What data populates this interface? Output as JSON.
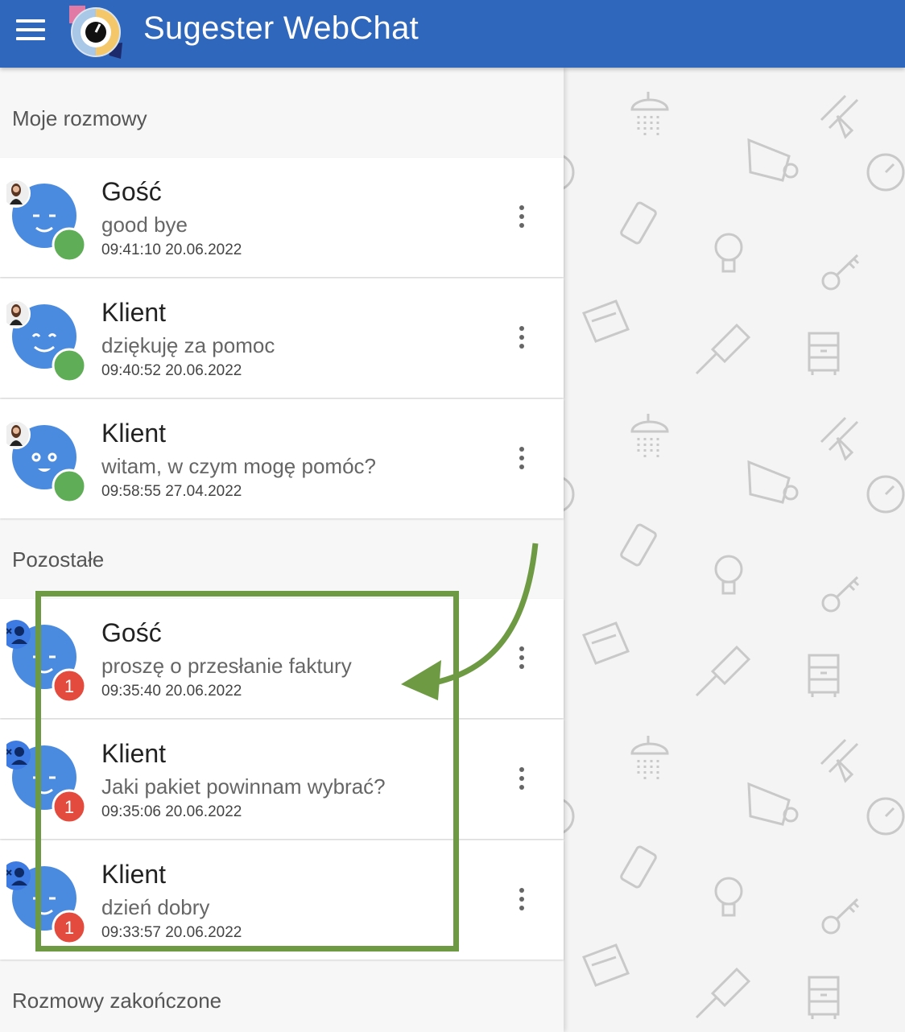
{
  "header": {
    "title": "Sugester WebChat",
    "colors": {
      "bar": "#2f67bd"
    }
  },
  "sections": [
    {
      "title": "Moje rozmowy"
    },
    {
      "title": "Pozostałe"
    },
    {
      "title": "Rozmowy zakończone"
    }
  ],
  "conversations": [
    {
      "name": "Gość",
      "message": "good bye",
      "time": "09:41:10 20.06.2022",
      "avatar_face": "wink",
      "status": "online",
      "owner": "agent-photo"
    },
    {
      "name": "Klient",
      "message": "dziękuję za pomoc",
      "time": "09:40:52 20.06.2022",
      "avatar_face": "smile",
      "status": "online",
      "owner": "agent-photo"
    },
    {
      "name": "Klient",
      "message": "witam, w czym mogę pomóc?",
      "time": "09:58:55 27.04.2022",
      "avatar_face": "surprised",
      "status": "online",
      "owner": "agent-photo"
    },
    {
      "name": "Gość",
      "message": "proszę o przesłanie faktury",
      "time": "09:35:40 20.06.2022",
      "avatar_face": "wink",
      "unread": "1",
      "owner": "unassigned"
    },
    {
      "name": "Klient",
      "message": "Jaki pakiet powinnam wybrać?",
      "time": "09:35:06 20.06.2022",
      "avatar_face": "wink",
      "unread": "1",
      "owner": "unassigned"
    },
    {
      "name": "Klient",
      "message": "dzień dobry",
      "time": "09:33:57 20.06.2022",
      "avatar_face": "wink",
      "unread": "1",
      "owner": "unassigned"
    }
  ],
  "colors": {
    "avatar": "#4a8be0",
    "online": "#5fad56",
    "unread": "#e24b3d",
    "annotation": "#6e9a43"
  }
}
